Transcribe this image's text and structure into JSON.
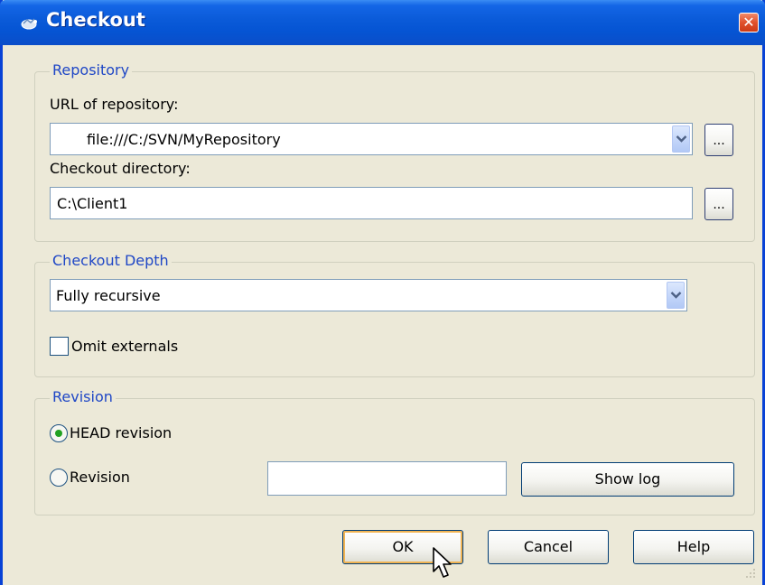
{
  "window": {
    "title": "Checkout",
    "close_glyph": "✕"
  },
  "repository": {
    "legend": "Repository",
    "url_label": "URL of repository:",
    "url_value": "file:///C:/SVN/MyRepository",
    "dir_label": "Checkout directory:",
    "dir_value": "C:\\Client1",
    "browse_label": "..."
  },
  "depth": {
    "legend": "Checkout Depth",
    "value": "Fully recursive",
    "omit_externals_label": "Omit externals",
    "omit_externals_checked": false
  },
  "revision": {
    "legend": "Revision",
    "head_label": "HEAD revision",
    "head_selected": true,
    "revision_label": "Revision",
    "revision_value": "",
    "show_log_label": "Show log"
  },
  "buttons": {
    "ok": "OK",
    "cancel": "Cancel",
    "help": "Help"
  },
  "colors": {
    "titlebar": "#0a5ad8",
    "legend_text": "#1f47c6",
    "dialog_bg": "#ece9d8"
  },
  "icons": {
    "title": "tortoise-icon",
    "close": "close-icon",
    "dropdown": "chevron-down-icon",
    "cursor": "mouse-pointer-icon"
  }
}
